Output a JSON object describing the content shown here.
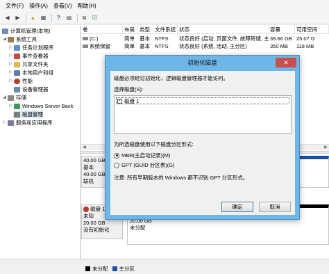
{
  "menu": [
    "文件(F)",
    "操作(A)",
    "查看(V)",
    "帮助(H)"
  ],
  "tree": {
    "root": "计算机管理(本地)",
    "system_tools": "系统工具",
    "task_scheduler": "任务计划程序",
    "event_viewer": "事件查看器",
    "shared_folders": "共享文件夹",
    "local_users": "本地用户和组",
    "performance": "性能",
    "device_manager": "设备管理器",
    "storage": "存储",
    "windows_server_backup": "Windows Server Back",
    "disk_management": "磁盘管理",
    "services_apps": "服务和应用程序"
  },
  "volumes": {
    "headers": [
      "卷",
      "布局",
      "类型",
      "文件系统",
      "状态",
      "容量",
      "可用空间"
    ],
    "rows": [
      [
        "(C:)",
        "简单",
        "基本",
        "NTFS",
        "状态良好 (启动, 页面文件, 故障转储, 主分区)",
        "39.66 GB",
        "25.07 G"
      ],
      [
        "系统保留",
        "简单",
        "基本",
        "NTFS",
        "状态良好 (系统, 活动, 主分区)",
        "350 MB",
        "118 MB"
      ]
    ]
  },
  "disks": {
    "disk0": {
      "size": "40.00 GB",
      "type": "基本",
      "size2": "40.00 GB",
      "status": "联机"
    },
    "disk1": {
      "name": "磁盘 1",
      "type": "未知",
      "size": "20.00 GB",
      "status": "没有初始化",
      "part_size": "20.00 GB",
      "part_status": "未分配"
    }
  },
  "legend": {
    "unallocated": "未分配",
    "primary": "主分区"
  },
  "dialog": {
    "title": "初始化磁盘",
    "close": "✕",
    "intro": "磁盘必须经过初始化，逻辑磁盘管理器才能访问。",
    "select_label": "选择磁盘(S):",
    "disk_item": "磁盘 1",
    "style_label": "为所选磁盘使用以下磁盘分区形式:",
    "mbr_label": "MBR(主启动记录)(M)",
    "gpt_label": "GPT (GUID 分区表)(G)",
    "note": "注意: 所有早期版本的 Windows 都不识别 GPT 分区形式。",
    "ok": "确定",
    "cancel": "取消"
  },
  "colors": {
    "dialog_frame": "#6fb6e8",
    "close_button": "#c7504f",
    "unallocated": "#000000",
    "primary": "#1c4fa3"
  }
}
